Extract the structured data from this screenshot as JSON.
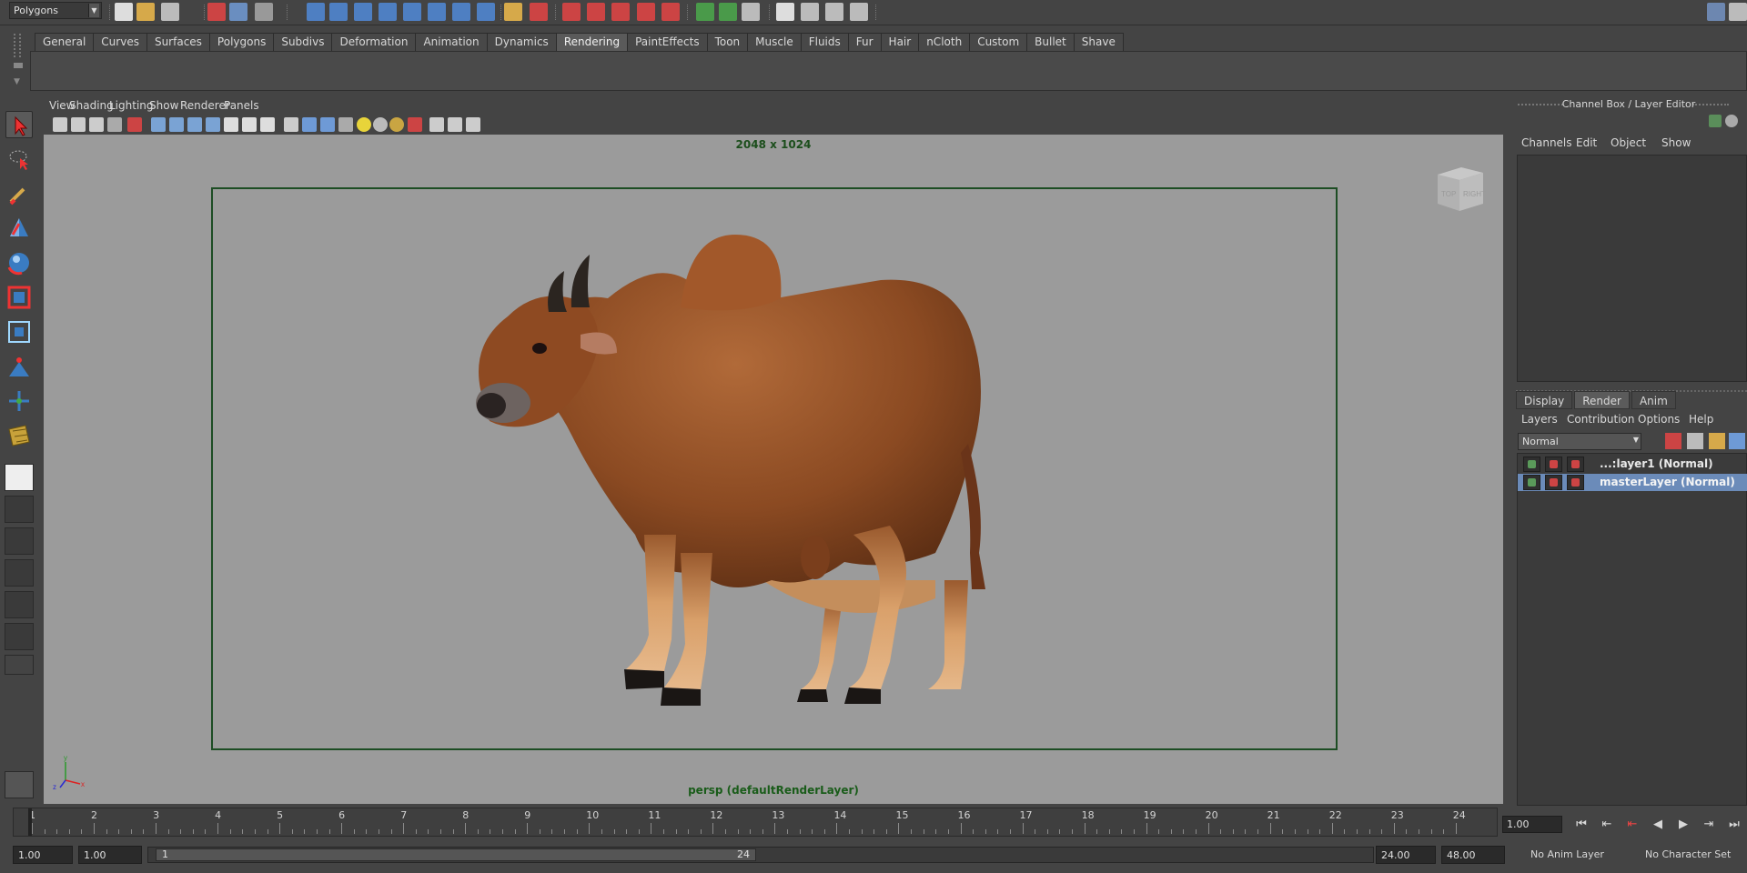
{
  "statusline": {
    "mode": "Polygons"
  },
  "shelf": {
    "tabs": [
      "General",
      "Curves",
      "Surfaces",
      "Polygons",
      "Subdivs",
      "Deformation",
      "Animation",
      "Dynamics",
      "Rendering",
      "PaintEffects",
      "Toon",
      "Muscle",
      "Fluids",
      "Fur",
      "Hair",
      "nCloth",
      "Custom",
      "Bullet",
      "Shave"
    ],
    "active_tab": "Rendering"
  },
  "viewport": {
    "menus": [
      "View",
      "Shading",
      "Lighting",
      "Show",
      "Renderer",
      "Panels"
    ],
    "resolution": "2048 x 1024",
    "camera": "persp (defaultRenderLayer)",
    "view_cube": {
      "top": "TOP",
      "right": "RIGHT"
    },
    "gate_color": "#1d4d24",
    "bg_color": "#9b9b9b"
  },
  "channel_box": {
    "title": "Channel Box / Layer Editor",
    "menus": [
      "Channels",
      "Edit",
      "Object",
      "Show"
    ]
  },
  "layer_editor": {
    "tabs": [
      "Display",
      "Render",
      "Anim"
    ],
    "active_tab": "Render",
    "menus": [
      "Layers",
      "Contribution",
      "Options",
      "Help"
    ],
    "blend_mode": "Normal",
    "layers": [
      {
        "name": "...:layer1 (Normal)",
        "selected": false
      },
      {
        "name": "masterLayer (Normal)",
        "selected": true
      }
    ],
    "selected_color": "#6b8bb9"
  },
  "timeline": {
    "ticks": [
      "1",
      "2",
      "3",
      "4",
      "5",
      "6",
      "7",
      "8",
      "9",
      "10",
      "11",
      "12",
      "13",
      "14",
      "15",
      "16",
      "17",
      "18",
      "19",
      "20",
      "21",
      "22",
      "23",
      "24"
    ],
    "current_time": "1.00"
  },
  "range": {
    "start": "1.00",
    "playback_start": "1.00",
    "slider_min": "1",
    "slider_max": "24",
    "playback_end": "24.00",
    "end": "48.00",
    "anim_layer": "No Anim Layer",
    "character_set": "No Character Set"
  }
}
